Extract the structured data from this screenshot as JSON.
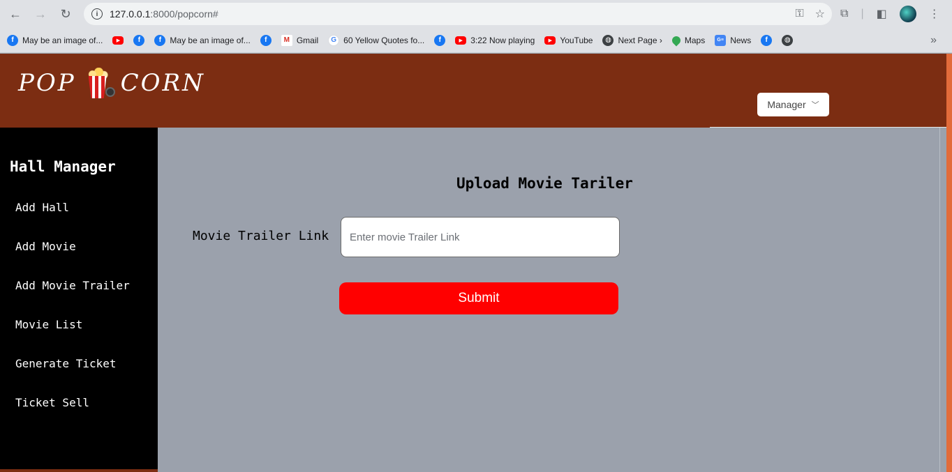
{
  "browser": {
    "url_host": "127.0.0.1",
    "url_path": ":8000/popcorn#",
    "bookmarks": [
      {
        "icon": "facebook-icon",
        "label": "May be an image of..."
      },
      {
        "icon": "youtube-icon",
        "label": ""
      },
      {
        "icon": "facebook-icon",
        "label": ""
      },
      {
        "icon": "facebook-icon",
        "label": "May be an image of..."
      },
      {
        "icon": "facebook-icon",
        "label": ""
      },
      {
        "icon": "gmail-icon",
        "label": "Gmail"
      },
      {
        "icon": "google-icon",
        "label": "60 Yellow Quotes fo..."
      },
      {
        "icon": "facebook-icon",
        "label": ""
      },
      {
        "icon": "youtube-icon",
        "label": "3:22 Now playing"
      },
      {
        "icon": "youtube-icon",
        "label": "YouTube"
      },
      {
        "icon": "globe-icon",
        "label": "Next Page ›"
      },
      {
        "icon": "maps-icon",
        "label": "Maps"
      },
      {
        "icon": "news-icon",
        "label": "News"
      },
      {
        "icon": "facebook-icon",
        "label": ""
      },
      {
        "icon": "globe-icon",
        "label": ""
      }
    ]
  },
  "header": {
    "logo_left": "POP",
    "logo_right": "CORN",
    "manager_label": "Manager"
  },
  "sidebar": {
    "title": "Hall Manager",
    "items": [
      {
        "label": "Add Hall"
      },
      {
        "label": "Add Movie"
      },
      {
        "label": "Add Movie Trailer"
      },
      {
        "label": "Movie List"
      },
      {
        "label": "Generate Ticket"
      },
      {
        "label": "Ticket Sell"
      }
    ]
  },
  "form": {
    "title": "Upload Movie Tariler",
    "label": "Movie Trailer Link",
    "input_value": "",
    "input_placeholder": "Enter movie Trailer Link",
    "submit_label": "Submit"
  },
  "colors": {
    "header_bg": "#7c2d12",
    "sidebar_bg": "#000000",
    "main_bg": "#9ba1ac",
    "submit_bg": "#ff0000"
  }
}
